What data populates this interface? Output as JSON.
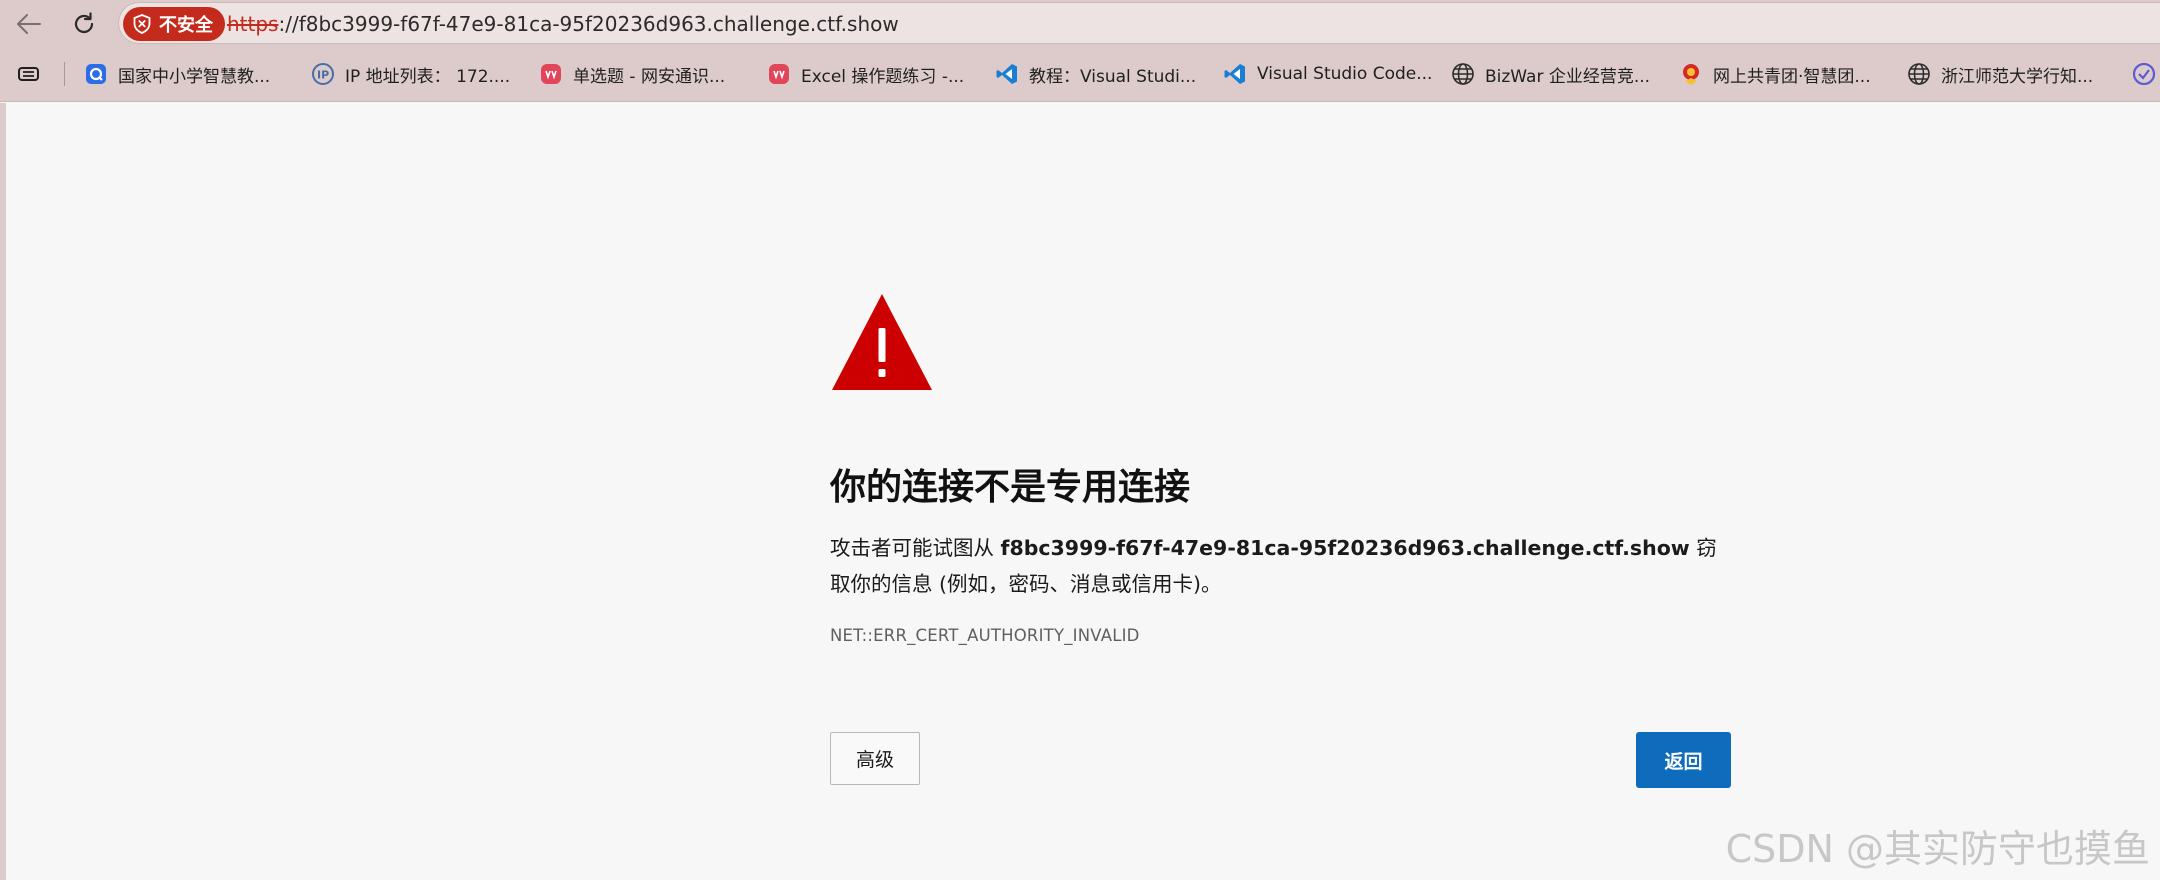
{
  "address_bar": {
    "security_badge": "不安全",
    "url_scheme": "https",
    "url_rest": "://f8bc3999-f67f-47e9-81ca-95f20236d963.challenge.ctf.show"
  },
  "bookmarks": [
    {
      "label": "国家中小学智慧教...",
      "icon": "smartedu-icon"
    },
    {
      "label": "IP 地址列表： 172....",
      "icon": "ip-icon"
    },
    {
      "label": "单选题 - 网安通识...",
      "icon": "quiz-icon"
    },
    {
      "label": "Excel 操作题练习 -...",
      "icon": "quiz-icon"
    },
    {
      "label": "教程：Visual Studi...",
      "icon": "vscode-icon"
    },
    {
      "label": "Visual Studio Code...",
      "icon": "vscode-icon"
    },
    {
      "label": "BizWar 企业经营竞...",
      "icon": "globe-icon"
    },
    {
      "label": "网上共青团·智慧团...",
      "icon": "league-icon"
    },
    {
      "label": "浙江师范大学行知...",
      "icon": "globe-icon"
    }
  ],
  "error_page": {
    "title": "你的连接不是专用连接",
    "desc_prefix": "攻击者可能试图从 ",
    "desc_host": "f8bc3999-f67f-47e9-81ca-95f20236d963.challenge.ctf.show",
    "desc_suffix": " 窃取你的信息 (例如，密码、消息或信用卡)。",
    "error_code": "NET::ERR_CERT_AUTHORITY_INVALID",
    "advanced_label": "高级",
    "back_label": "返回"
  },
  "watermark": "CSDN @其实防守也摸鱼",
  "colors": {
    "chrome_bg": "#dccbca",
    "insecure_red": "#c42b1c",
    "warning_red": "#cc0000",
    "primary_blue": "#0f6cbd",
    "page_bg": "#f7f7f7"
  }
}
